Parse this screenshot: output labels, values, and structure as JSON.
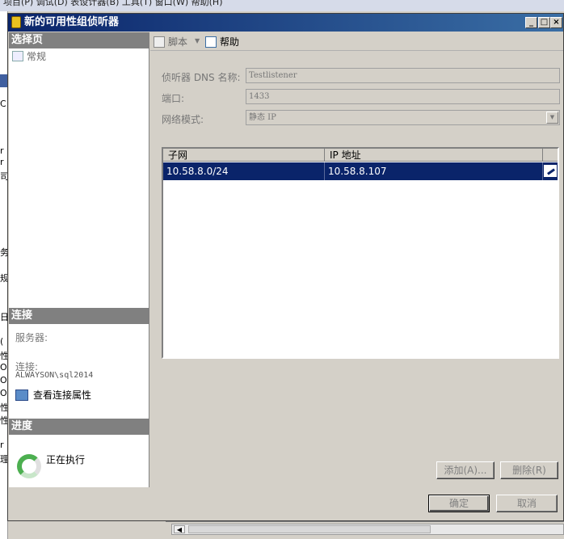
{
  "background": {
    "menubar_text": "项目(P)   调试(D)   表设计器(B)   工具(T)   窗口(W)   帮助(H)",
    "left_strip_chars": [
      "C",
      "r",
      "r",
      "司",
      "务",
      "规",
      "日",
      "(",
      "性",
      "O",
      "O",
      "O",
      "性",
      "性",
      "r",
      "理"
    ]
  },
  "dialog": {
    "title": "新的可用性组侦听器",
    "window_buttons": [
      "_",
      "□",
      "×"
    ],
    "left": {
      "select_page_header": "选择页",
      "pages": [
        "常规"
      ],
      "connection_header": "连接",
      "server_label": "服务器:",
      "server_value": "",
      "connection_label": "连接:",
      "connection_value": "ALWAYSON\\sql2014",
      "view_props_link": "查看连接属性",
      "progress_header": "进度",
      "progress_text": "正在执行"
    },
    "toolbar": {
      "script_label": "脚本",
      "help_label": "帮助"
    },
    "form": {
      "dns_label": "侦听器 DNS 名称:",
      "dns_value": "Testlistener",
      "port_label": "端口:",
      "port_value": "1433",
      "network_mode_label": "网络模式:",
      "network_mode_value": "静态 IP"
    },
    "grid": {
      "columns": [
        "子网",
        "IP 地址"
      ],
      "rows": [
        {
          "subnet": "10.58.8.0/24",
          "ip": "10.58.8.107"
        }
      ]
    },
    "buttons": {
      "add": "添加(A)...",
      "remove": "删除(R)",
      "ok": "确定",
      "cancel": "取消"
    }
  }
}
